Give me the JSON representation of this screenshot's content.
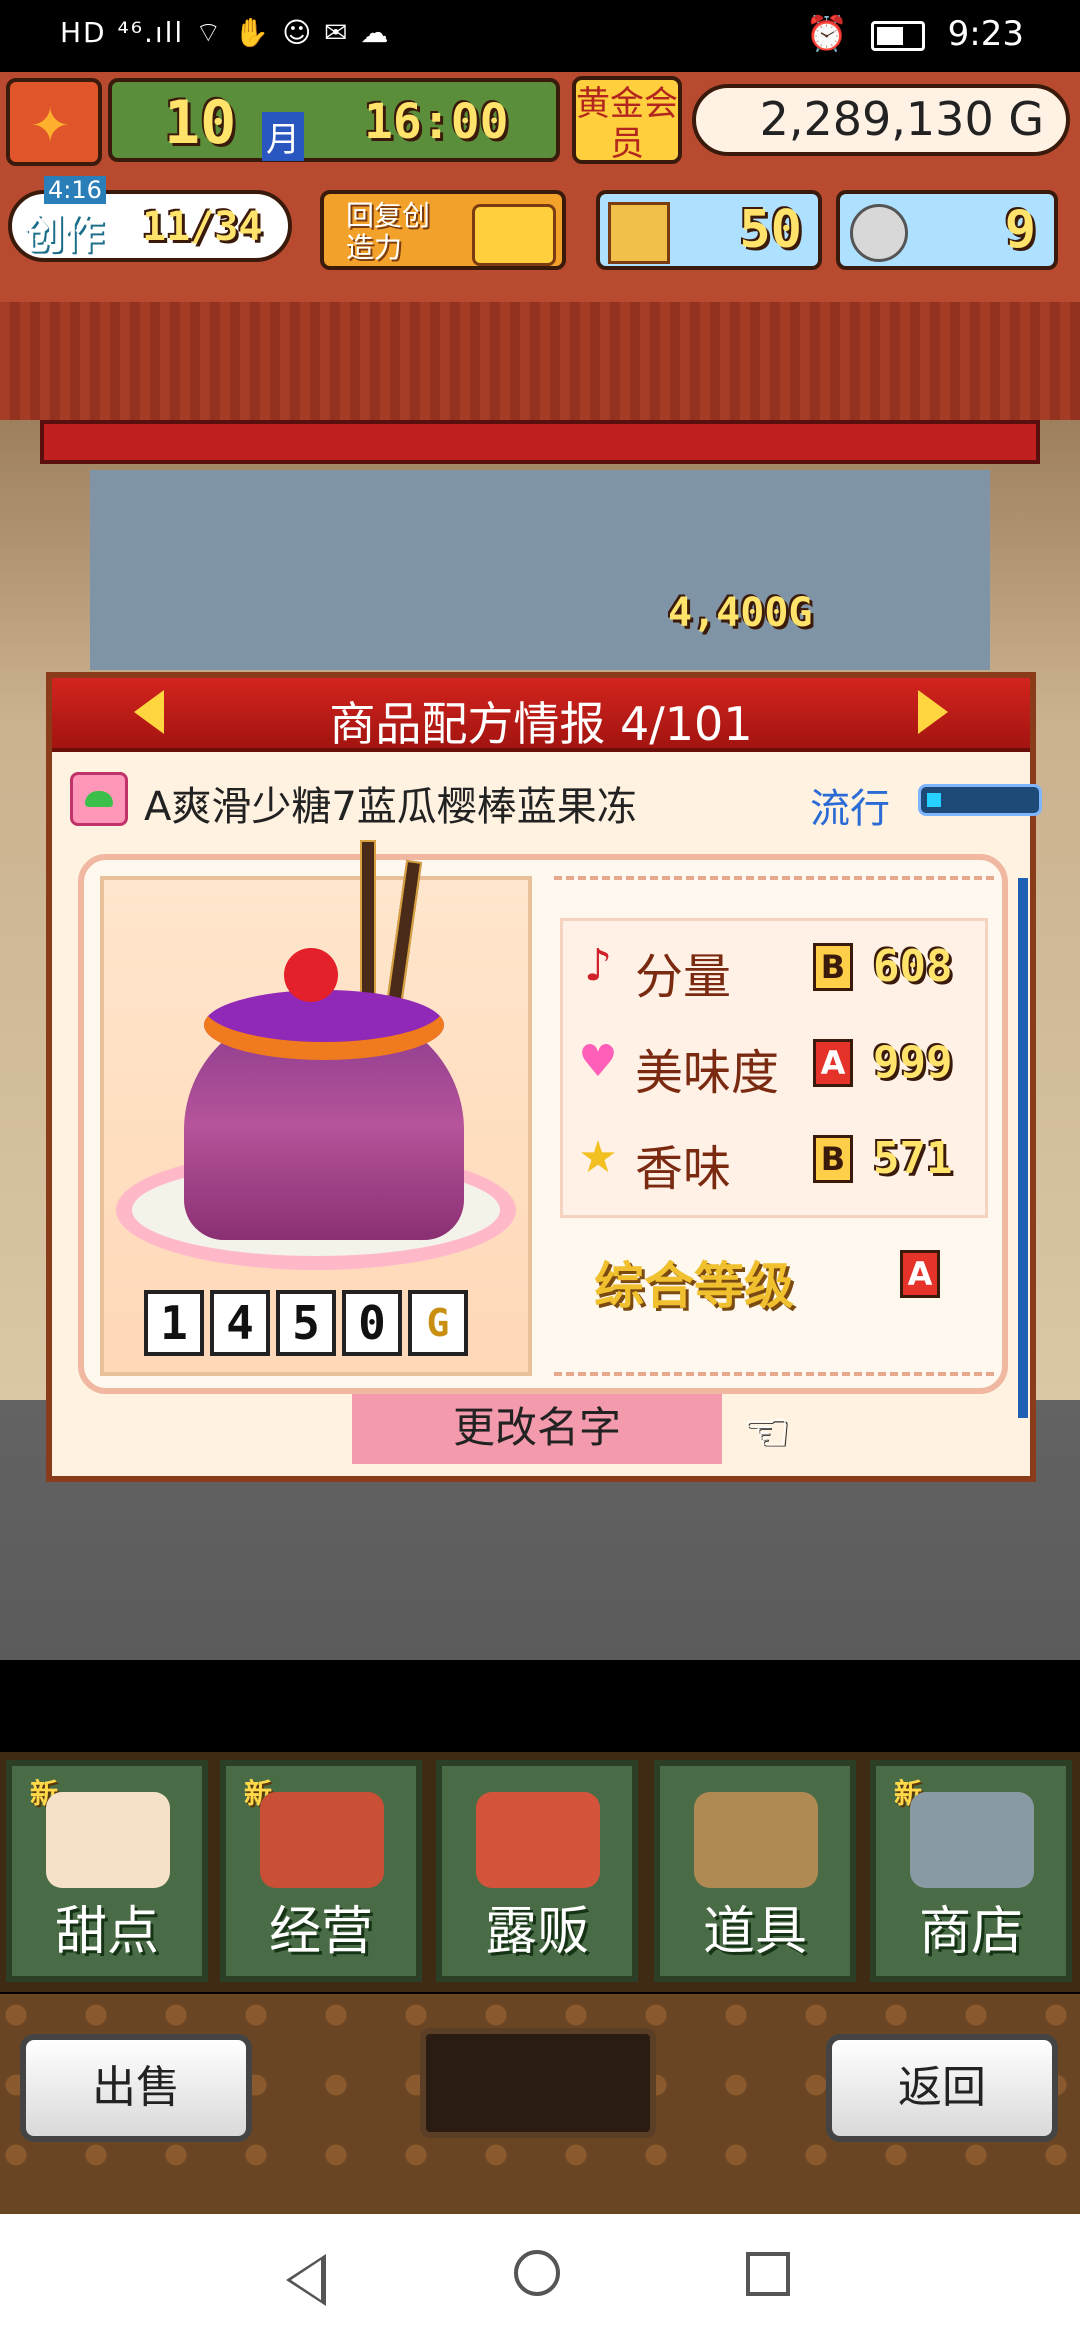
{
  "status_bar": {
    "left_indicators": "HD ⁴⁶.ıll ⌔ ✋ ☺ ✉ ☁",
    "time": "9:23"
  },
  "hud": {
    "month_value": "10",
    "month_unit": "月",
    "clock": "16:00",
    "gold_member_label": "黄金会员",
    "money": "2,289,130 G",
    "create_label": "创作",
    "create_timer": "4:16",
    "create_progress": "11/34",
    "restore_label": "回复创造力",
    "ticket_count": "50",
    "coin_count": "9"
  },
  "scene": {
    "earning_popup": "4,400G"
  },
  "dialog": {
    "title": "商品配方情报 4/101",
    "recipe_name": "A爽滑少糖7蓝瓜樱棒蓝果冻",
    "trend_label": "流行",
    "price_digits": [
      "1",
      "4",
      "5",
      "0",
      "G"
    ],
    "stats": [
      {
        "icon": "note-icon",
        "symbol": "♪",
        "label": "分量",
        "grade": "B",
        "value": "608"
      },
      {
        "icon": "heart-icon",
        "symbol": "♥",
        "label": "美味度",
        "grade": "A",
        "value": "999"
      },
      {
        "icon": "star-icon",
        "symbol": "★",
        "label": "香味",
        "grade": "B",
        "value": "571"
      }
    ],
    "overall_label": "综合等级",
    "overall_grade": "A",
    "rename_label": "更改名字"
  },
  "menu": {
    "items": [
      {
        "label": "甜点",
        "new": "新"
      },
      {
        "label": "经营",
        "new": "新"
      },
      {
        "label": "露贩",
        "new": ""
      },
      {
        "label": "道具",
        "new": ""
      },
      {
        "label": "商店",
        "new": "新"
      }
    ]
  },
  "bottom": {
    "sell_label": "出售",
    "back_label": "返回"
  },
  "colors": {
    "header_red": "#c01f1f",
    "accent_gold": "#ffe36a",
    "menu_green": "#496c46"
  }
}
